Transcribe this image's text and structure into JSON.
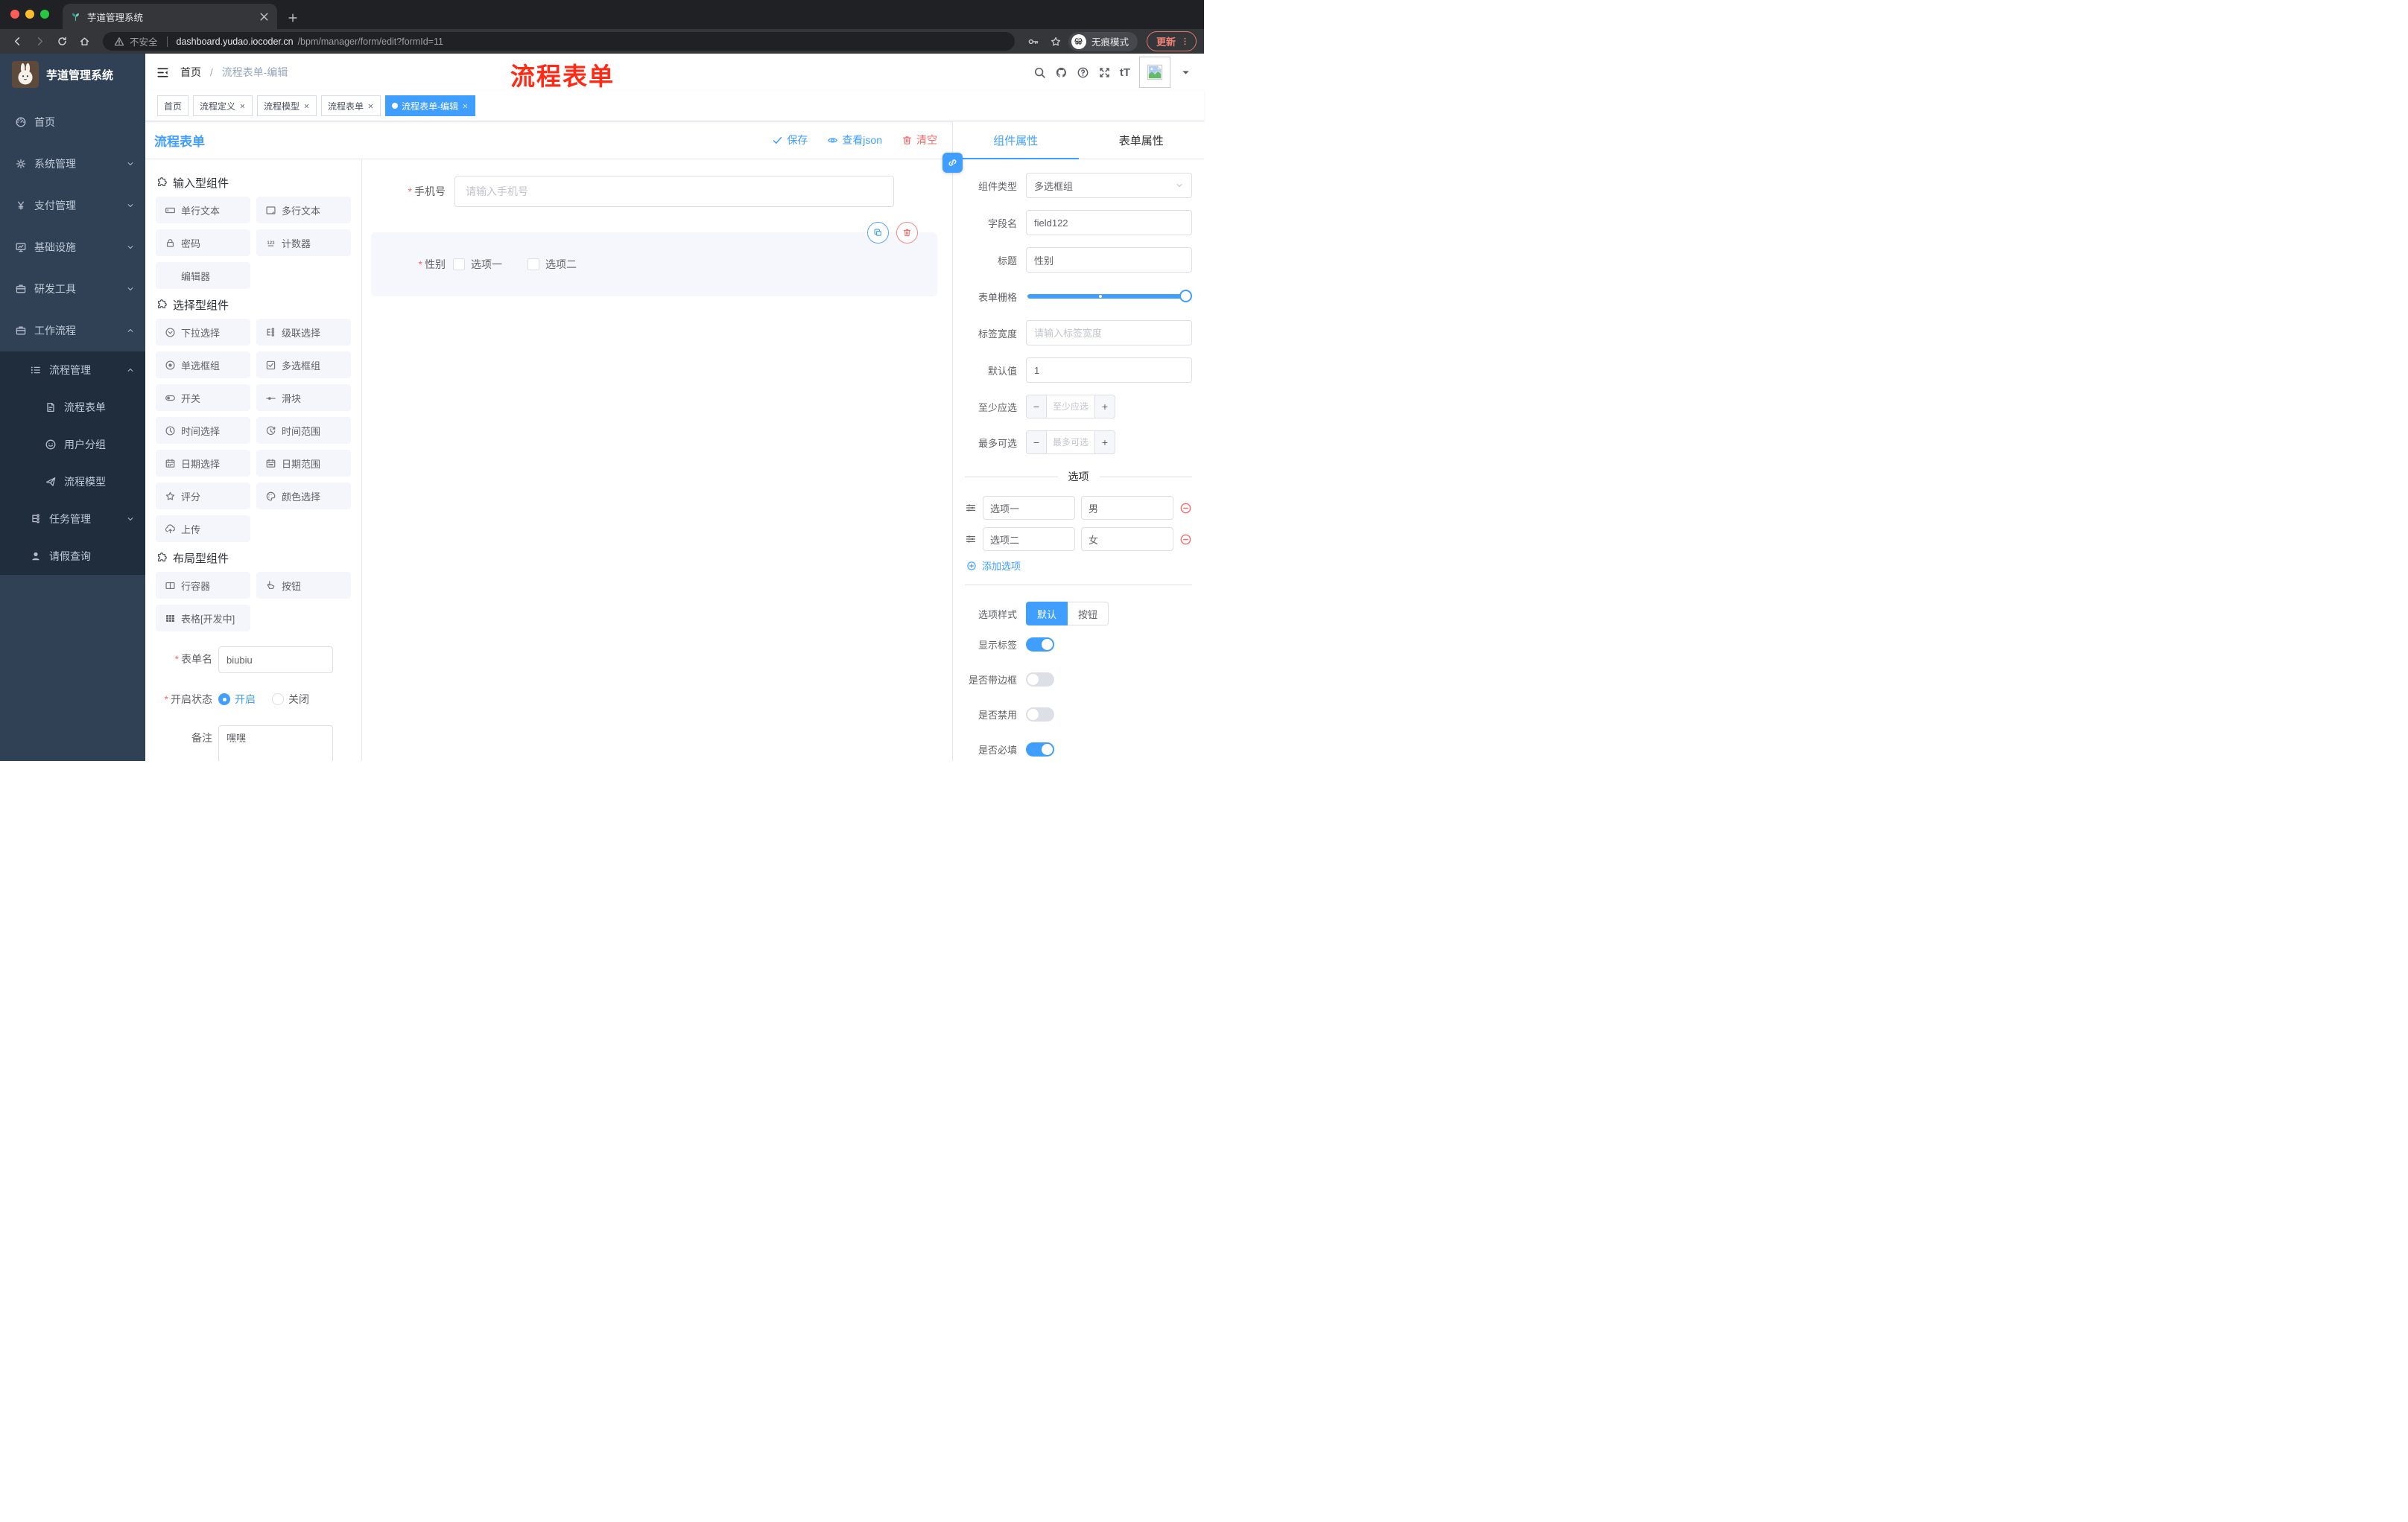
{
  "browser": {
    "tab_title": "芋道管理系统",
    "security_label": "不安全",
    "url_host": "dashboard.yudao.iocoder.cn",
    "url_path": "/bpm/manager/form/edit?formId=11",
    "incognito_label": "无痕模式",
    "update_button": "更新"
  },
  "sidebar": {
    "logo_title": "芋道管理系统",
    "menu": [
      {
        "label": "首页",
        "icon": "dashboard",
        "level": 1,
        "chevron": "",
        "sub": false
      },
      {
        "label": "系统管理",
        "icon": "gear",
        "level": 1,
        "chevron": "down",
        "sub": false
      },
      {
        "label": "支付管理",
        "icon": "money",
        "level": 1,
        "chevron": "down",
        "sub": false
      },
      {
        "label": "基础设施",
        "icon": "monitor",
        "level": 1,
        "chevron": "down",
        "sub": false
      },
      {
        "label": "研发工具",
        "icon": "briefcase",
        "level": 1,
        "chevron": "down",
        "sub": false
      },
      {
        "label": "工作流程",
        "icon": "briefcase",
        "level": 1,
        "chevron": "up",
        "sub": false
      },
      {
        "label": "流程管理",
        "icon": "list",
        "level": 2,
        "chevron": "up",
        "sub": true
      },
      {
        "label": "流程表单",
        "icon": "form",
        "level": 3,
        "chevron": "",
        "sub": true
      },
      {
        "label": "用户分组",
        "icon": "robot",
        "level": 3,
        "chevron": "",
        "sub": true
      },
      {
        "label": "流程模型",
        "icon": "plane",
        "level": 3,
        "chevron": "",
        "sub": true
      },
      {
        "label": "任务管理",
        "icon": "tree",
        "level": 2,
        "chevron": "down",
        "sub": true
      },
      {
        "label": "请假查询",
        "icon": "user",
        "level": 2,
        "chevron": "",
        "sub": true
      }
    ]
  },
  "navbar": {
    "breadcrumb_home": "首页",
    "breadcrumb_sep": "/",
    "breadcrumb_current": "流程表单-编辑",
    "annotation": "流程表单"
  },
  "tags": [
    {
      "label": "首页",
      "closable": false,
      "active": false
    },
    {
      "label": "流程定义",
      "closable": true,
      "active": false
    },
    {
      "label": "流程模型",
      "closable": true,
      "active": false
    },
    {
      "label": "流程表单",
      "closable": true,
      "active": false
    },
    {
      "label": "流程表单-编辑",
      "closable": true,
      "active": true
    }
  ],
  "editor": {
    "title": "流程表单",
    "save": "保存",
    "view_json": "查看json",
    "clear": "清空"
  },
  "components": {
    "sections": [
      {
        "title": "输入型组件",
        "items": [
          {
            "label": "单行文本",
            "icon": "input"
          },
          {
            "label": "多行文本",
            "icon": "textarea"
          },
          {
            "label": "密码",
            "icon": "lock"
          },
          {
            "label": "计数器",
            "icon": "counter"
          },
          {
            "label": "编辑器",
            "icon": ""
          }
        ]
      },
      {
        "title": "选择型组件",
        "items": [
          {
            "label": "下拉选择",
            "icon": "select"
          },
          {
            "label": "级联选择",
            "icon": "cascade"
          },
          {
            "label": "单选框组",
            "icon": "radio"
          },
          {
            "label": "多选框组",
            "icon": "checkbox"
          },
          {
            "label": "开关",
            "icon": "switch"
          },
          {
            "label": "滑块",
            "icon": "slider"
          },
          {
            "label": "时间选择",
            "icon": "time"
          },
          {
            "label": "时间范围",
            "icon": "timerange"
          },
          {
            "label": "日期选择",
            "icon": "date"
          },
          {
            "label": "日期范围",
            "icon": "daterange"
          },
          {
            "label": "评分",
            "icon": "star"
          },
          {
            "label": "颜色选择",
            "icon": "palette"
          },
          {
            "label": "上传",
            "icon": "upload"
          }
        ]
      },
      {
        "title": "布局型组件",
        "items": [
          {
            "label": "行容器",
            "icon": "columns"
          },
          {
            "label": "按钮",
            "icon": "pointer"
          },
          {
            "label": "表格[开发中]",
            "icon": "table"
          }
        ]
      }
    ]
  },
  "form_meta": {
    "name_label": "表单名",
    "name_value": "biubiu",
    "status_label": "开启状态",
    "status_on": "开启",
    "status_off": "关闭",
    "status_selected": "开启",
    "remark_label": "备注",
    "remark_value": "嘿嘿"
  },
  "canvas": {
    "phone_label": "手机号",
    "phone_placeholder": "请输入手机号",
    "gender_label": "性别",
    "gender_options": [
      "选项一",
      "选项二"
    ]
  },
  "inspector": {
    "tab_component": "组件属性",
    "tab_form": "表单属性",
    "type_label": "组件类型",
    "type_value": "多选框组",
    "field_label": "字段名",
    "field_value": "field122",
    "title_label": "标题",
    "title_value": "性别",
    "grid_label": "表单栅格",
    "label_width_label": "标签宽度",
    "label_width_placeholder": "请输入标签宽度",
    "default_label": "默认值",
    "default_value": "1",
    "min_label": "至少应选",
    "min_placeholder": "至少应选",
    "max_label": "最多可选",
    "max_placeholder": "最多可选",
    "options_divider": "选项",
    "options": [
      {
        "label": "选项一",
        "value": "男"
      },
      {
        "label": "选项二",
        "value": "女"
      }
    ],
    "add_option": "添加选项",
    "style_label": "选项样式",
    "style_default": "默认",
    "style_button": "按钮",
    "style_selected": "默认",
    "switches": [
      {
        "label": "显示标签",
        "on": true
      },
      {
        "label": "是否带边框",
        "on": false
      },
      {
        "label": "是否禁用",
        "on": false
      },
      {
        "label": "是否必填",
        "on": true
      }
    ]
  },
  "colors": {
    "primary": "#409eff",
    "danger": "#f56c6c",
    "annotation_red": "#fd2b16",
    "sidebar_bg": "#304156",
    "submenu_bg": "#1f2d3d"
  }
}
